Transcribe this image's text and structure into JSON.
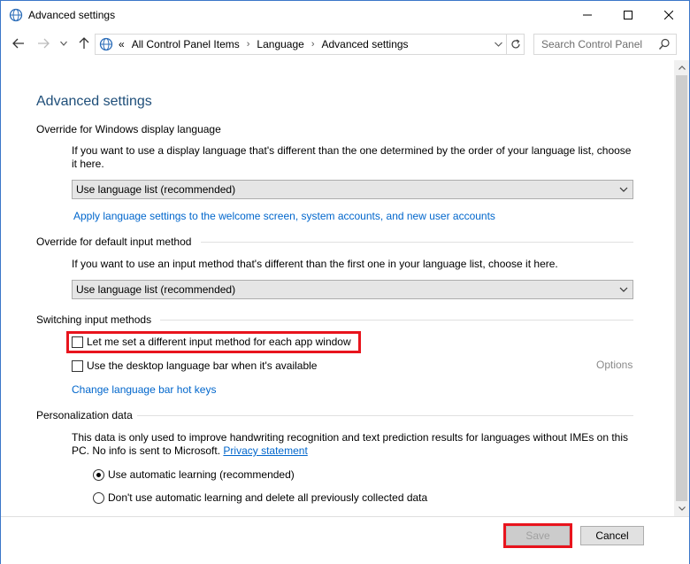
{
  "window": {
    "title": "Advanced settings"
  },
  "address": {
    "overflow": "«",
    "crumbs": [
      "All Control Panel Items",
      "Language",
      "Advanced settings"
    ]
  },
  "search": {
    "placeholder": "Search Control Panel"
  },
  "page": {
    "title": "Advanced settings",
    "sections": {
      "display_language": {
        "heading": "Override for Windows display language",
        "description": "If you want to use a display language that's different than the one determined by the order of your language list, choose it here.",
        "select_value": "Use language list (recommended)",
        "link": "Apply language settings to the welcome screen, system accounts, and new user accounts"
      },
      "input_method": {
        "heading": "Override for default input method",
        "description": "If you want to use an input method that's different than the first one in your language list, choose it here.",
        "select_value": "Use language list (recommended)"
      },
      "switching": {
        "heading": "Switching input methods",
        "checkbox1": "Let me set a different input method for each app window",
        "checkbox2": "Use the desktop language bar when it's available",
        "options_link": "Options",
        "hotkeys_link": "Change language bar hot keys"
      },
      "personalization": {
        "heading": "Personalization data",
        "description": "This data is only used to improve handwriting recognition and text prediction results for languages without IMEs on this PC. No info is sent to Microsoft.",
        "privacy_link": "Privacy statement",
        "radio1": "Use automatic learning (recommended)",
        "radio2": "Don't use automatic learning and delete all previously collected data"
      }
    }
  },
  "footer": {
    "save_label": "Save",
    "cancel_label": "Cancel"
  },
  "colors": {
    "title_blue": "#1e4e79",
    "link_blue": "#0066cc",
    "highlight_red": "#e8141d"
  }
}
